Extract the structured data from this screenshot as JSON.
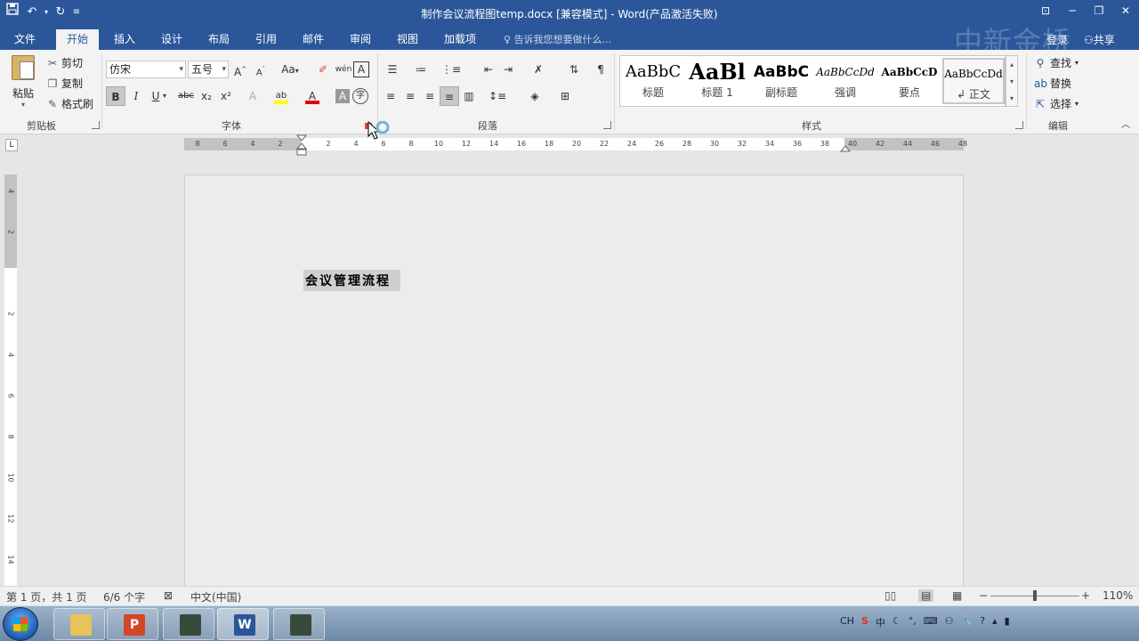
{
  "window": {
    "title": "制作会议流程图temp.docx [兼容模式] - Word(产品激活失败)"
  },
  "qat": {
    "save_icon": "save-icon",
    "undo_icon": "undo-icon",
    "redo_icon": "redo-icon"
  },
  "tabs": [
    {
      "label": "文件"
    },
    {
      "label": "开始"
    },
    {
      "label": "插入"
    },
    {
      "label": "设计"
    },
    {
      "label": "布局"
    },
    {
      "label": "引用"
    },
    {
      "label": "邮件"
    },
    {
      "label": "审阅"
    },
    {
      "label": "视图"
    },
    {
      "label": "加载项"
    }
  ],
  "tellme": "告诉我您想要做什么...",
  "login": "登录",
  "share": "共享",
  "watermark": "中新金桥",
  "ribbon": {
    "clipboard": {
      "paste": "粘贴",
      "cut": "剪切",
      "copy": "复制",
      "format_painter": "格式刷",
      "label": "剪贴板"
    },
    "font": {
      "family": "仿宋",
      "size": "五号",
      "grow": "A",
      "shrink": "A",
      "case": "Aa",
      "phonetic": "wén",
      "border_char": "A",
      "bold": "B",
      "italic": "I",
      "underline": "U",
      "strike": "abc",
      "sub": "x₂",
      "sup": "x²",
      "effects": "A",
      "highlight": "ab",
      "color": "A",
      "shading": "A",
      "enclose": "字",
      "label": "字体",
      "highlight_color": "#ffff00",
      "font_color": "#e00000"
    },
    "paragraph": {
      "label": "段落"
    },
    "styles": {
      "label": "样式",
      "items": [
        {
          "sample": "AaBbC",
          "name": "标题"
        },
        {
          "sample": "AaBl",
          "name": "标题 1"
        },
        {
          "sample": "AaBbC",
          "name": "副标题"
        },
        {
          "sample": "AaBbCcDd",
          "name": "强调"
        },
        {
          "sample": "AaBbCcD",
          "name": "要点"
        },
        {
          "sample": "AaBbCcDd",
          "name": "↲ 正文"
        }
      ]
    },
    "editing": {
      "find": "查找",
      "replace": "替换",
      "select": "选择",
      "label": "编辑"
    }
  },
  "ruler": {
    "corner": "L",
    "h_left_ticks": [
      "8",
      "6",
      "4",
      "2"
    ],
    "h_right_ticks": [
      "2",
      "4",
      "6",
      "8",
      "10",
      "12",
      "14",
      "16",
      "18",
      "20",
      "22",
      "24",
      "26",
      "28",
      "30",
      "32",
      "34",
      "36",
      "38",
      "40",
      "42",
      "44",
      "46",
      "48"
    ],
    "v_ticks": [
      "4",
      "2",
      "2",
      "4",
      "6",
      "8",
      "10",
      "12",
      "14"
    ]
  },
  "document": {
    "text": "会议管理流程"
  },
  "status": {
    "page": "第 1 页，共 1 页",
    "words": "6/6 个字",
    "language": "中文(中国)",
    "zoom": "110%"
  },
  "taskbar": {
    "apps": [
      {
        "name": "file-explorer",
        "glyph": "",
        "color": "#e8c25a"
      },
      {
        "name": "powerpoint",
        "glyph": "P",
        "color": "#d24726"
      },
      {
        "name": "app-3",
        "glyph": "",
        "color": "#3a4a3a"
      },
      {
        "name": "word",
        "glyph": "W",
        "color": "#2b579a"
      },
      {
        "name": "app-5",
        "glyph": "",
        "color": "#3a4a3a"
      }
    ],
    "tray_lang": "CH",
    "tray_ime": "中"
  }
}
